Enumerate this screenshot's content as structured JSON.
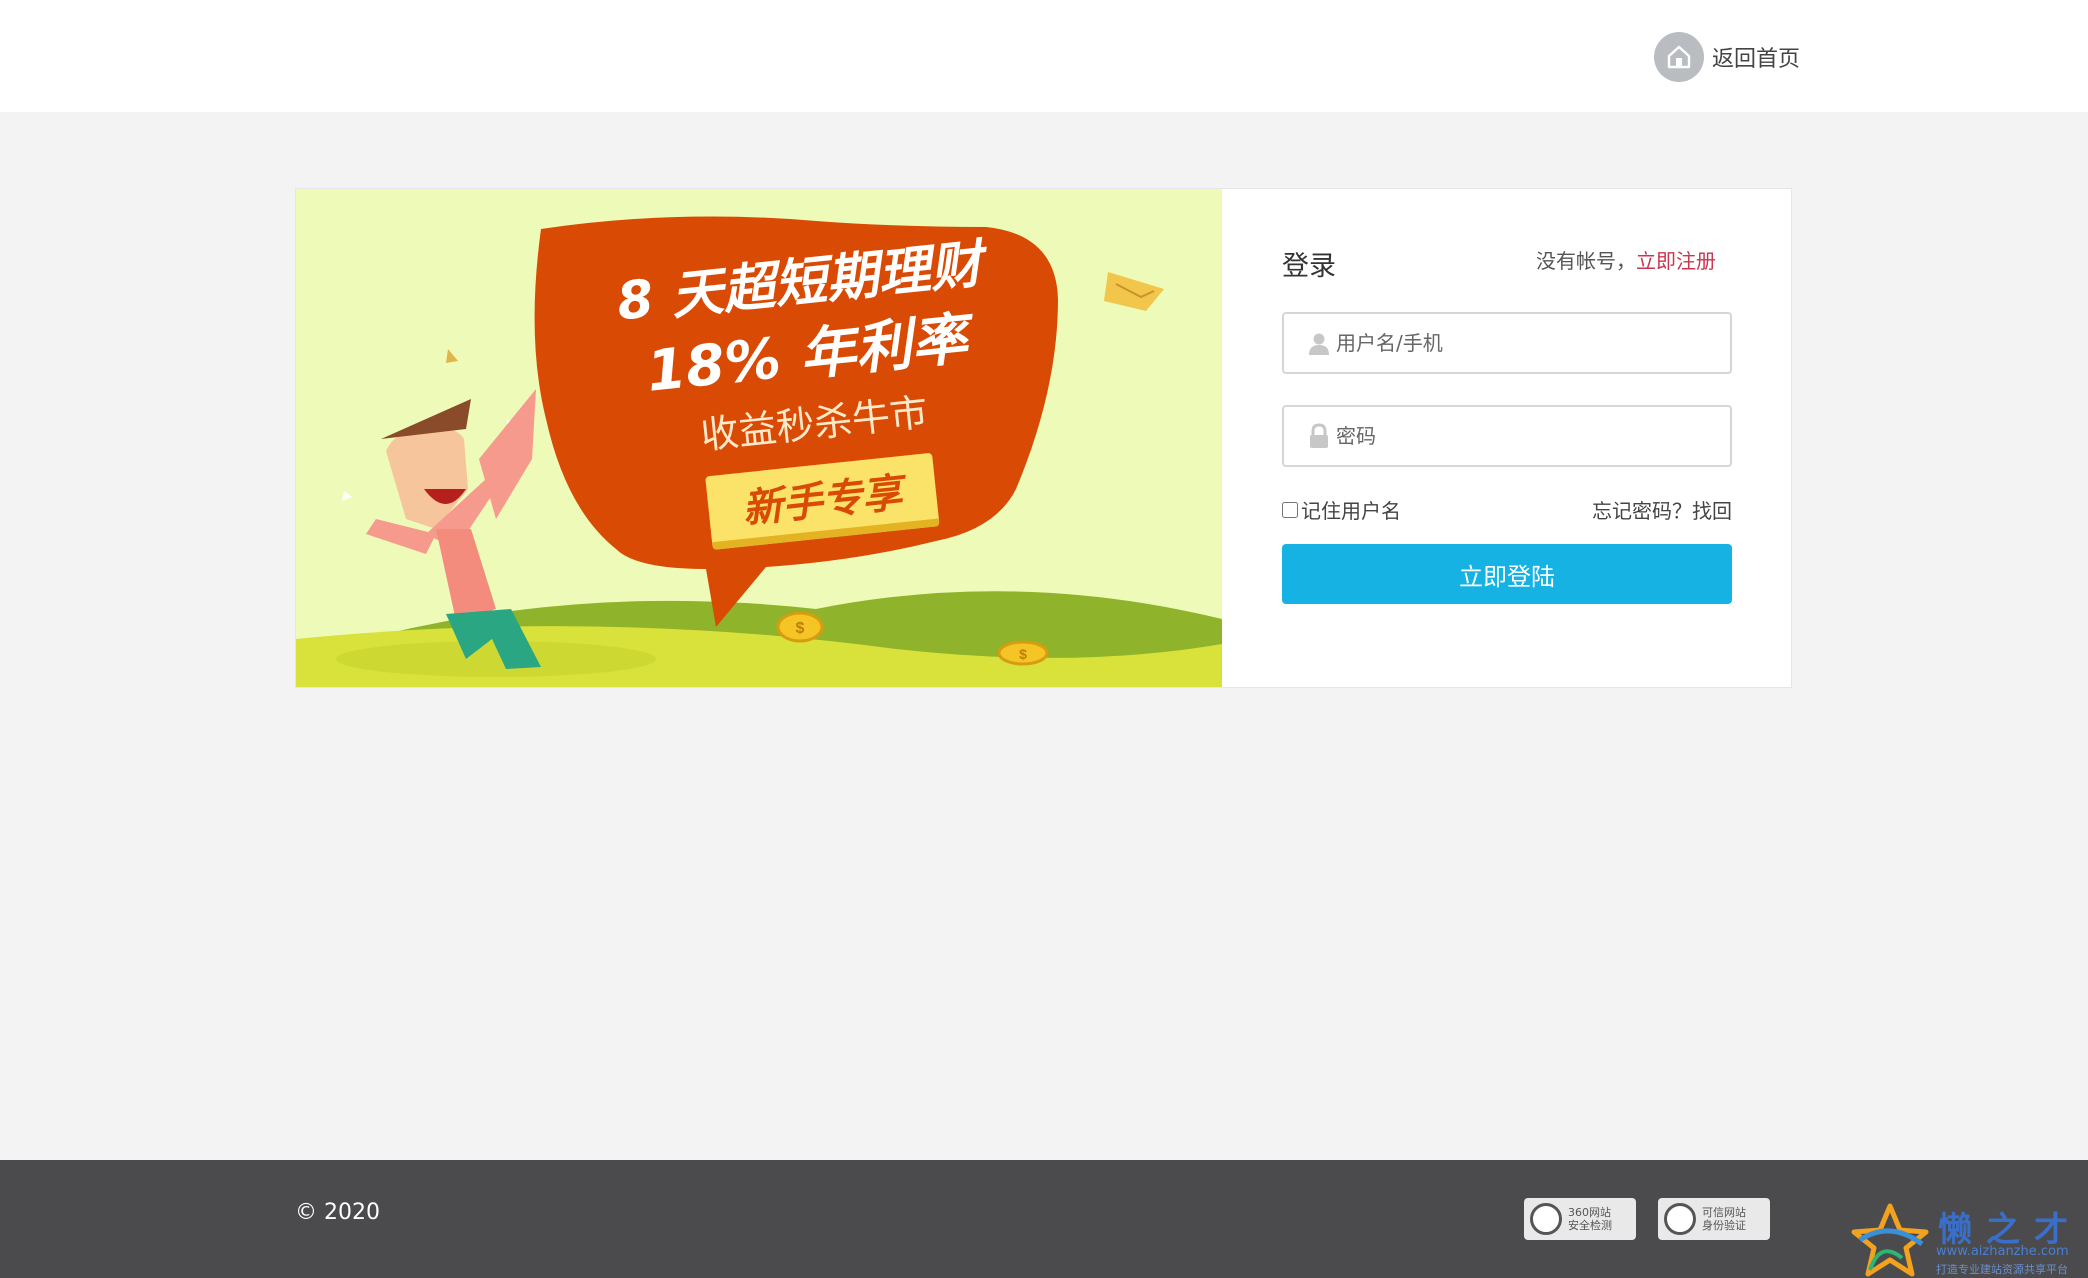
{
  "header": {
    "home_label": "返回首页"
  },
  "banner": {
    "line1": "8 天超短期理财",
    "line2": "18% 年利率",
    "line3": "收益秒杀牛市",
    "cta": "新手专享"
  },
  "login": {
    "title": "登录",
    "no_account": "没有帐号，",
    "register": "立即注册",
    "username_placeholder": "用户名/手机",
    "password_placeholder": "密码",
    "remember_label": "记住用户名",
    "forgot": "忘记密码？找回",
    "submit": "立即登陆"
  },
  "footer": {
    "copyright": "© 2020",
    "badge_360_line1": "360网站",
    "badge_360_line2": "安全检测",
    "badge_trust_line1": "可信网站",
    "badge_trust_line2": "身份验证"
  },
  "watermark": {
    "title": "懒之才",
    "url": "www.aizhanzhe.com",
    "slogan": "打造专业建站资源共享平台"
  },
  "colors": {
    "primary_button": "#16b2e4",
    "register_link": "#c8364f",
    "footer_bg": "#4b4b4d",
    "banner_bubble": "#d94a04"
  }
}
